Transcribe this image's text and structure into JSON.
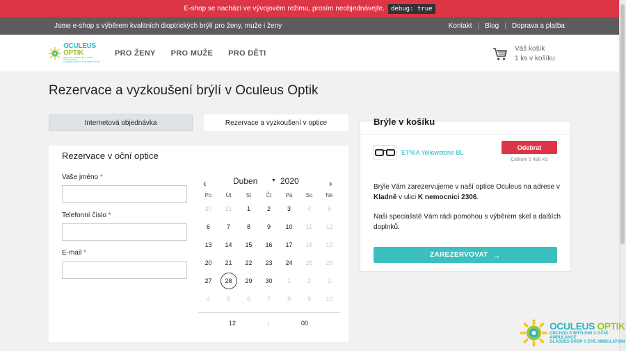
{
  "dev_bar": {
    "text": "E-shop se nachází ve vývojovém režimu, prosím neobjednávejte.",
    "code": "debug: true"
  },
  "info_bar": {
    "tagline": "Jsme e-shop s výběrem kvalitních dioptrických brýlí pro ženy, muže i ženy",
    "links": [
      "Kontakt",
      "Blog",
      "Doprava a platba"
    ],
    "separator": "|"
  },
  "header": {
    "logo": {
      "main_left": "OCULEUS",
      "main_right": "OPTIK",
      "sub1": "OBCHOD S BRÝLEMI © OČNÍ AMBULANCE",
      "sub2": "GLASSES SHOP © EYE AMBULATION"
    },
    "nav": [
      "PRO ŽENY",
      "PRO MUŽE",
      "PRO DĚTI"
    ],
    "cart": {
      "icon": "shopping-cart-icon",
      "title": "Váš košík",
      "count": "1 ks v košíku"
    }
  },
  "page": {
    "title": "Rezervace a vyzkoušení brýlí v Oculeus Optik"
  },
  "tabs": [
    {
      "label": "Internetová objednávka",
      "active": false
    },
    {
      "label": "Rezervace a vyzkoušení v optice",
      "active": true
    }
  ],
  "form": {
    "heading": "Rezervace v oční optice",
    "fields": [
      {
        "label": "Vaše jméno",
        "required": "*",
        "value": ""
      },
      {
        "label": "Telefonní číslo",
        "required": "*",
        "value": ""
      },
      {
        "label": "E-mail",
        "required": "*",
        "value": ""
      }
    ]
  },
  "calendar": {
    "prev": "‹",
    "next": "›",
    "month": "Duben",
    "caret": "▼",
    "year": "2020",
    "weekdays": [
      "Po",
      "Út",
      "St",
      "Čt",
      "Pá",
      "So",
      "Ne"
    ],
    "days": [
      [
        "30",
        "31",
        "1",
        "2",
        "3",
        "4",
        "5"
      ],
      [
        "6",
        "7",
        "8",
        "9",
        "10",
        "11",
        "12"
      ],
      [
        "13",
        "14",
        "15",
        "16",
        "17",
        "18",
        "19"
      ],
      [
        "20",
        "21",
        "22",
        "23",
        "24",
        "25",
        "26"
      ],
      [
        "27",
        "28",
        "29",
        "30",
        "1",
        "2",
        "3"
      ],
      [
        "4",
        "5",
        "6",
        "7",
        "8",
        "9",
        "10"
      ]
    ],
    "muted": [
      [
        true,
        true,
        false,
        false,
        false,
        true,
        true
      ],
      [
        false,
        false,
        false,
        false,
        false,
        true,
        true
      ],
      [
        false,
        false,
        false,
        false,
        false,
        true,
        true
      ],
      [
        false,
        false,
        false,
        false,
        false,
        true,
        true
      ],
      [
        false,
        false,
        false,
        false,
        true,
        true,
        true
      ],
      [
        true,
        true,
        true,
        true,
        true,
        true,
        true
      ]
    ],
    "today": {
      "row": 4,
      "col": 1
    },
    "time": {
      "hour": "12",
      "sep": ":",
      "minute": "00"
    }
  },
  "cart_card": {
    "title": "Brýle v košíku",
    "product": {
      "name": "ETNIA Yellowstone BL",
      "remove_label": "Odebrat",
      "total": "Celkem 5 490 Kč"
    },
    "text1_a": "Brýle Vám zarezervujeme v naší optice Oculeus na adrese v ",
    "text1_city": "Kladně",
    "text1_b": " v ulici ",
    "text1_street": "K nemocnici 2306",
    "text1_end": ".",
    "text2": "Naši specialisté Vám rádi pomohou s výběrem skel a dalších doplnků.",
    "cta_label": "ZAREZERVOVAT",
    "cta_arrow": "→"
  },
  "colors": {
    "red": "#dc3545",
    "teal": "#3bbfbf",
    "brand_blue": "#2bb5c5",
    "brand_green": "#9fc531"
  }
}
